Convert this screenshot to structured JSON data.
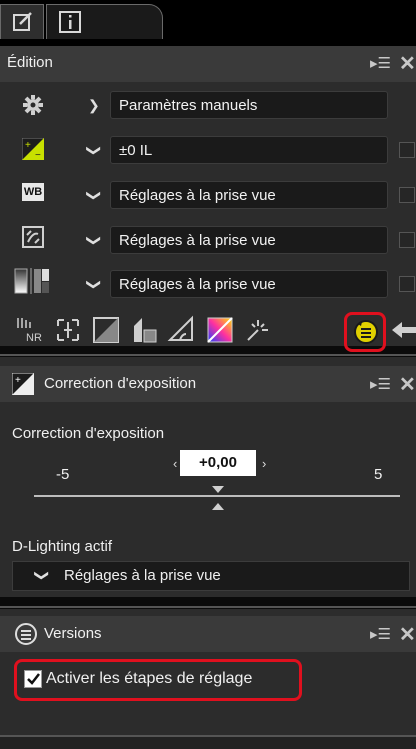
{
  "tabs": [
    {
      "icon": "edit-icon",
      "glyph": "✎"
    },
    {
      "icon": "info-icon",
      "glyph": "ⓘ"
    }
  ],
  "edition_panel": {
    "title": "Édition",
    "rows": [
      {
        "icon": "gear-icon",
        "value": "Paramètres manuels"
      },
      {
        "icon": "exposure-icon",
        "value": "±0 IL"
      },
      {
        "icon": "white-balance-icon",
        "value": "Réglages à la prise vue"
      },
      {
        "icon": "picture-control-icon",
        "value": "Réglages à la prise vue"
      },
      {
        "icon": "tone-icon",
        "value": "Réglages à la prise vue"
      }
    ],
    "wb_badge": "WB",
    "toolbar_icons": [
      "noise-reduction-icon",
      "crop-icon",
      "levels-curves-icon",
      "color-booster-icon",
      "straighten-icon",
      "color-adjust-icon",
      "retouch-brush-icon",
      "versions-icon",
      "arrow-icon"
    ],
    "nr_text": "NR"
  },
  "exposure_panel": {
    "title": "Correction d'exposition",
    "label": "Correction d'exposition",
    "value": "+0,00",
    "min_label": "-5",
    "max_label": "5",
    "dlighting_label": "D-Lighting actif",
    "dlighting_value": "Réglages à la prise vue"
  },
  "versions_panel": {
    "title": "Versions",
    "checkbox_label": "Activer les étapes de réglage",
    "checked": true
  },
  "colors": {
    "accent_highlight": "#e0101e",
    "exposure_icon": "#c8e000"
  }
}
